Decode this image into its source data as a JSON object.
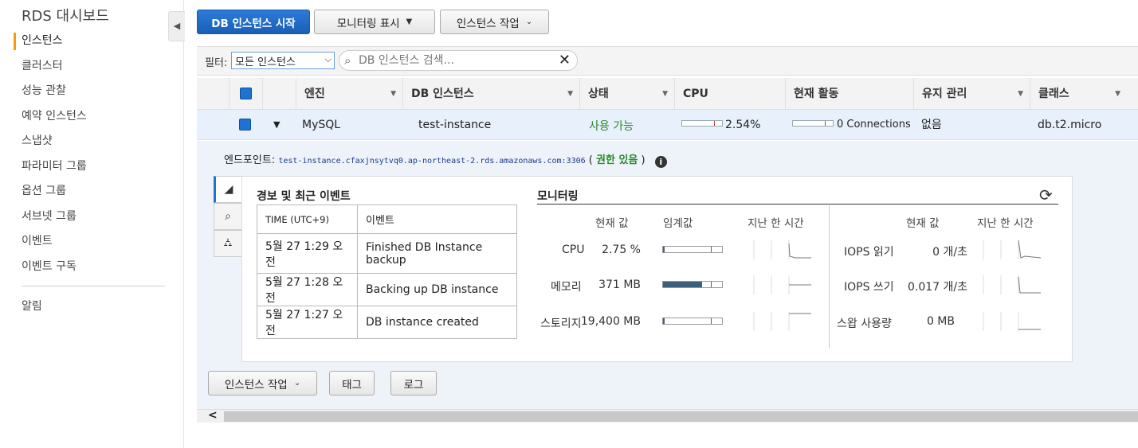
{
  "sidebar": {
    "title": "RDS 대시보드",
    "items": [
      "인스턴스",
      "클러스터",
      "성능 관찰",
      "예약 인스턴스",
      "스냅샷",
      "파라미터 그룹",
      "옵션 그룹",
      "서브넷 그룹",
      "이벤트",
      "이벤트 구독"
    ],
    "extra": "알림"
  },
  "toolbar": {
    "launch": "DB 인스턴스 시작",
    "monitoring": "모니터링 표시",
    "actions": "인스턴스 작업"
  },
  "filter": {
    "label": "필터:",
    "selected": "모든 인스턴스",
    "search_placeholder": "DB 인스턴스 검색..."
  },
  "table": {
    "columns": [
      "엔진",
      "DB 인스턴스",
      "상태",
      "CPU",
      "현재 활동",
      "유지 관리",
      "클래스"
    ],
    "row": {
      "engine": "MySQL",
      "instance": "test-instance",
      "status": "사용 가능",
      "cpu": "2.54%",
      "cpu_fraction": 0.0254,
      "activity": "0 Connections",
      "maintenance": "없음",
      "class": "db.t2.micro",
      "status_color": "#2a8a2a"
    }
  },
  "detail": {
    "endpoint_label": "엔드포인트:",
    "endpoint_value": "test-instance.cfaxjnsytvq0.ap-northeast-2.rds.amazonaws.com:3306",
    "endpoint_paren_open": "(",
    "endpoint_grant": "권한 있음",
    "endpoint_paren_close": ")",
    "events": {
      "title": "경보 및 최근 이벤트",
      "col_time": "TIME (UTC+9)",
      "col_event": "이벤트",
      "rows": [
        {
          "time": "5월 27 1:29 오전",
          "event": "Finished DB Instance backup"
        },
        {
          "time": "5월 27 1:28 오전",
          "event": "Backing up DB instance"
        },
        {
          "time": "5월 27 1:27 오전",
          "event": "DB instance created"
        }
      ]
    },
    "monitoring": {
      "title": "모니터링",
      "headers": {
        "current": "현재 값",
        "threshold": "임계값",
        "last_hour": "지난 한 시간"
      },
      "left": [
        {
          "label": "CPU",
          "value": "2.75 %",
          "fraction": 0.03
        },
        {
          "label": "메모리",
          "value": "371 MB",
          "fraction": 0.66
        },
        {
          "label": "스토리지",
          "value": "19,400 MB",
          "fraction": 0.03
        }
      ],
      "right": [
        {
          "label": "IOPS 읽기",
          "value": "0 개/초"
        },
        {
          "label": "IOPS 쓰기",
          "value": "0.017 개/초"
        },
        {
          "label": "스왑 사용량",
          "value": "0 MB"
        }
      ]
    }
  },
  "bottom": {
    "actions": "인스턴스 작업",
    "tags": "태그",
    "logs": "로그"
  }
}
